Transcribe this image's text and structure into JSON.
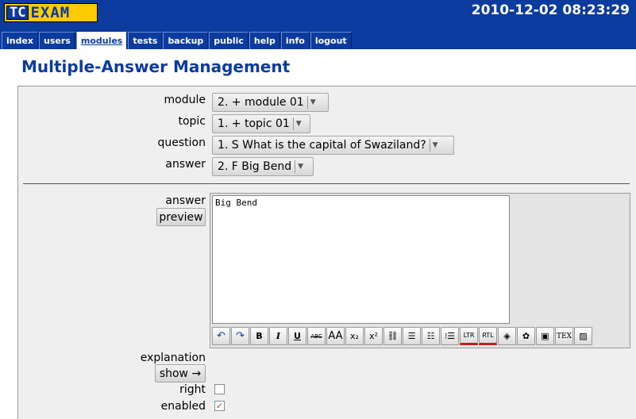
{
  "header": {
    "logo_left": "TC",
    "logo_right": "EXAM",
    "datetime": "2010-12-02 08:23:29"
  },
  "menu": [
    {
      "label": "index",
      "active": false
    },
    {
      "label": "users",
      "active": false
    },
    {
      "label": "modules",
      "active": true
    },
    {
      "label": "tests",
      "active": false
    },
    {
      "label": "backup",
      "active": false
    },
    {
      "label": "public",
      "active": false
    },
    {
      "label": "help",
      "active": false
    },
    {
      "label": "info",
      "active": false
    },
    {
      "label": "logout",
      "active": false
    }
  ],
  "page": {
    "title": "Multiple-Answer Management"
  },
  "form": {
    "module": {
      "label": "module",
      "selected": "2. + module 01"
    },
    "topic": {
      "label": "topic",
      "selected": "1. + topic 01"
    },
    "question": {
      "label": "question",
      "selected": "1. S What is the capital of Swaziland?"
    },
    "answer": {
      "label": "answer",
      "selected": "2. F Big Bend"
    },
    "answer_text": {
      "label": "answer",
      "preview_label": "preview",
      "value": "Big Bend"
    },
    "explanation": {
      "label": "explanation",
      "show_label": "show →"
    },
    "right": {
      "label": "right",
      "checked": false
    },
    "enabled": {
      "label": "enabled",
      "checked": true
    },
    "check_mark": "✓"
  },
  "toolbar": [
    {
      "icon": "undo-icon",
      "glyph": "↶"
    },
    {
      "icon": "redo-icon",
      "glyph": "↷"
    },
    {
      "icon": "bold-icon",
      "glyph": "B"
    },
    {
      "icon": "italic-icon",
      "glyph": "I"
    },
    {
      "icon": "underline-icon",
      "glyph": "U"
    },
    {
      "icon": "strikethrough-icon",
      "glyph": "ABC"
    },
    {
      "icon": "font-size-icon",
      "glyph": "AA"
    },
    {
      "icon": "subscript-icon",
      "glyph": "x₂"
    },
    {
      "icon": "superscript-icon",
      "glyph": "x²"
    },
    {
      "icon": "link-icon",
      "glyph": "⛓"
    },
    {
      "icon": "bullet-list-icon",
      "glyph": "☰"
    },
    {
      "icon": "numbered-list-icon",
      "glyph": "☷"
    },
    {
      "icon": "definition-list-icon",
      "glyph": "⁝☰"
    },
    {
      "icon": "ltr-icon",
      "glyph": "LTR"
    },
    {
      "icon": "rtl-icon",
      "glyph": "RTL"
    },
    {
      "icon": "fill-color-icon",
      "glyph": "◈"
    },
    {
      "icon": "palette-icon",
      "glyph": "✿"
    },
    {
      "icon": "display-icon",
      "glyph": "▣"
    },
    {
      "icon": "tex-icon",
      "glyph": "TEX"
    },
    {
      "icon": "image-icon",
      "glyph": "▨"
    }
  ],
  "colors": {
    "header_bg": "#0b3b9e",
    "logo_bg": "#ffcc00",
    "title": "#0b3b9e",
    "panel_bg": "#efefef"
  }
}
